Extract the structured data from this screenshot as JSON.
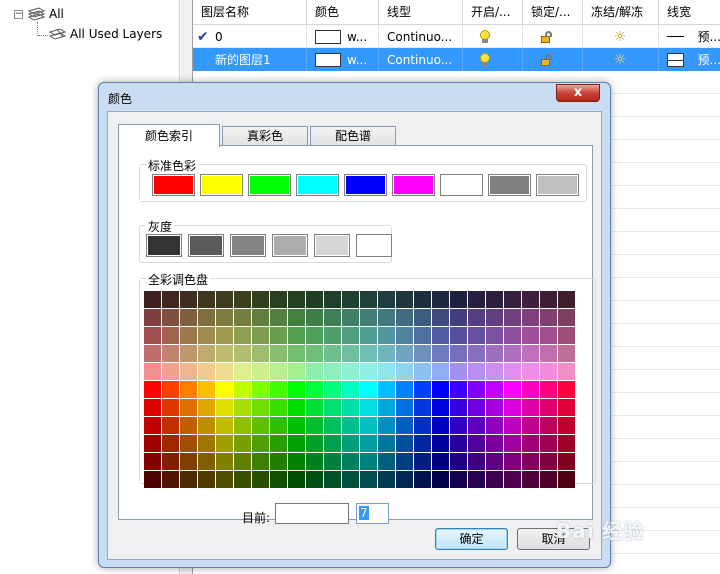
{
  "tree": {
    "root_label": "All",
    "child_label": "All Used Layers",
    "toggle": "−"
  },
  "grid": {
    "columns": [
      "图层名称",
      "颜色",
      "线型",
      "开启/...",
      "锁定/...",
      "冻结/解冻",
      "线宽"
    ],
    "rows": [
      {
        "check": "✔",
        "name": "0",
        "color_text": "w...",
        "linetype": "Continuo...",
        "lineweight": "预...",
        "selected": false
      },
      {
        "check": "",
        "name": "新的图层1",
        "color_text": "w...",
        "linetype": "Continuo...",
        "lineweight": "预...",
        "selected": true
      }
    ]
  },
  "dialog": {
    "title": "颜色",
    "close_label": "x",
    "tabs": [
      "颜色索引",
      "真彩色",
      "配色谱"
    ],
    "active_tab": 0,
    "standard_label": "标准色彩",
    "standard_colors": [
      "#ff0000",
      "#ffff00",
      "#00ff00",
      "#00ffff",
      "#0000ff",
      "#ff00ff",
      "#ffffff",
      "#808080",
      "#c0c0c0"
    ],
    "gray_label": "灰度",
    "gray_colors": [
      "#333333",
      "#5b5b5b",
      "#848484",
      "#adadad",
      "#d6d6d6",
      "#ffffff"
    ],
    "full_label": "全彩调色盘",
    "palette_rows": [
      [
        "#3f1f1f",
        "#3f261f",
        "#3f2e1f",
        "#3f361f",
        "#3f3d1f",
        "#393f1f",
        "#313f1f",
        "#2a3f1f",
        "#223f1f",
        "#1f3f22",
        "#1f3f2a",
        "#1f3f31",
        "#1f3f39",
        "#1f3d3f",
        "#1f363f",
        "#1f2e3f",
        "#1f263f",
        "#1f1f3f",
        "#261f3f",
        "#2e1f3f",
        "#361f3f",
        "#3f1f3d",
        "#3f1f36",
        "#3f1f2e"
      ],
      [
        "#7f3f3f",
        "#7f4f3f",
        "#7f5f3f",
        "#7f6f3f",
        "#7f7c3f",
        "#727f3f",
        "#637f3f",
        "#537f3f",
        "#437f3f",
        "#3f7f46",
        "#3f7f56",
        "#3f7f66",
        "#3f7f76",
        "#3f787f",
        "#3f6a7f",
        "#3f5b7f",
        "#3f4b7f",
        "#433f7f",
        "#533f7f",
        "#633f7f",
        "#723f7f",
        "#7f3f7c",
        "#7f3f6f",
        "#7f3f5f"
      ],
      [
        "#9f4f4f",
        "#9f634f",
        "#9f774f",
        "#9f8b4f",
        "#9f9c4f",
        "#8f9f4f",
        "#7c9f4f",
        "#689f4f",
        "#549f4f",
        "#4f9f58",
        "#4f9f6c",
        "#4f9f80",
        "#4f9f94",
        "#4f969f",
        "#4f849f",
        "#4f719f",
        "#4f5d9f",
        "#544f9f",
        "#684f9f",
        "#7c4f9f",
        "#8f4f9f",
        "#9f4f9c",
        "#9f4f8b",
        "#9f4f77"
      ],
      [
        "#bf6f6f",
        "#bf836f",
        "#bf976f",
        "#bfab6f",
        "#bfbc6f",
        "#afbf6f",
        "#9cbf6f",
        "#88bf6f",
        "#74bf6f",
        "#6fbf78",
        "#6fbf8c",
        "#6fbfa0",
        "#6fbfb4",
        "#6fb6bf",
        "#6fa4bf",
        "#6f91bf",
        "#6f7dbf",
        "#746fbf",
        "#886fbf",
        "#9c6fbf",
        "#af6fbf",
        "#bf6fbc",
        "#bf6fab",
        "#bf6f97"
      ],
      [
        "#ef8f8f",
        "#efa38f",
        "#efb78f",
        "#efcb8f",
        "#efdc8f",
        "#dfef8f",
        "#ccef8f",
        "#b8ef8f",
        "#a4ef8f",
        "#8fefa8",
        "#8fefbc",
        "#8fefd0",
        "#8fefe4",
        "#8fe6ef",
        "#8fd4ef",
        "#8fc1ef",
        "#8fadef",
        "#a48fef",
        "#b88fef",
        "#cc8fef",
        "#df8fef",
        "#ef8fec",
        "#ef8fdb",
        "#ef8fc7"
      ],
      [
        "#ff0000",
        "#ff3f00",
        "#ff7f00",
        "#ffbf00",
        "#ffff00",
        "#bfff00",
        "#7fff00",
        "#3fff00",
        "#00ff00",
        "#00ff3f",
        "#00ff7f",
        "#00ffbf",
        "#00ffff",
        "#00bfff",
        "#007fff",
        "#003fff",
        "#0000ff",
        "#3f00ff",
        "#7f00ff",
        "#bf00ff",
        "#ff00ff",
        "#ff00bf",
        "#ff007f",
        "#ff003f"
      ],
      [
        "#df0000",
        "#df3700",
        "#df6f00",
        "#dfa700",
        "#dfdf00",
        "#a7df00",
        "#6fdf00",
        "#37df00",
        "#00df00",
        "#00df37",
        "#00df6f",
        "#00dfa7",
        "#00dfdf",
        "#00a7df",
        "#006fdf",
        "#0037df",
        "#0000df",
        "#3700df",
        "#6f00df",
        "#a700df",
        "#df00df",
        "#df00a7",
        "#df006f",
        "#df0037"
      ],
      [
        "#bf0000",
        "#bf2f00",
        "#bf5f00",
        "#bf8f00",
        "#bfbf00",
        "#8fbf00",
        "#5fbf00",
        "#2fbf00",
        "#00bf00",
        "#00bf2f",
        "#00bf5f",
        "#00bf8f",
        "#00bfbf",
        "#008fbf",
        "#005fbf",
        "#002fbf",
        "#0000bf",
        "#2f00bf",
        "#5f00bf",
        "#8f00bf",
        "#bf00bf",
        "#bf008f",
        "#bf005f",
        "#bf002f"
      ],
      [
        "#9f0000",
        "#9f2700",
        "#9f4f00",
        "#9f7700",
        "#9f9f00",
        "#779f00",
        "#4f9f00",
        "#279f00",
        "#009f00",
        "#009f27",
        "#009f4f",
        "#009f77",
        "#009f9f",
        "#00779f",
        "#004f9f",
        "#00279f",
        "#00009f",
        "#27009f",
        "#4f009f",
        "#77009f",
        "#9f009f",
        "#9f0077",
        "#9f004f",
        "#9f0027"
      ],
      [
        "#7f0000",
        "#7f1f00",
        "#7f3f00",
        "#7f5f00",
        "#7f7f00",
        "#5f7f00",
        "#3f7f00",
        "#1f7f00",
        "#007f00",
        "#007f1f",
        "#007f3f",
        "#007f5f",
        "#007f7f",
        "#005f7f",
        "#003f7f",
        "#001f7f",
        "#00007f",
        "#1f007f",
        "#3f007f",
        "#5f007f",
        "#7f007f",
        "#7f005f",
        "#7f003f",
        "#7f001f"
      ],
      [
        "#4f0000",
        "#4f1300",
        "#4f2700",
        "#4f3b00",
        "#4f4f00",
        "#3b4f00",
        "#274f00",
        "#134f00",
        "#004f00",
        "#004f13",
        "#004f27",
        "#004f3b",
        "#004f4f",
        "#003b4f",
        "#00274f",
        "#00134f",
        "#00004f",
        "#13004f",
        "#27004f",
        "#3b004f",
        "#4f004f",
        "#4f003b",
        "#4f0027",
        "#4f0013"
      ]
    ],
    "current_label": "目前:",
    "current_color": "#ffffff",
    "index_value": "7",
    "ok_label": "确定",
    "cancel_label": "取消"
  },
  "watermark": "Bai 经验"
}
